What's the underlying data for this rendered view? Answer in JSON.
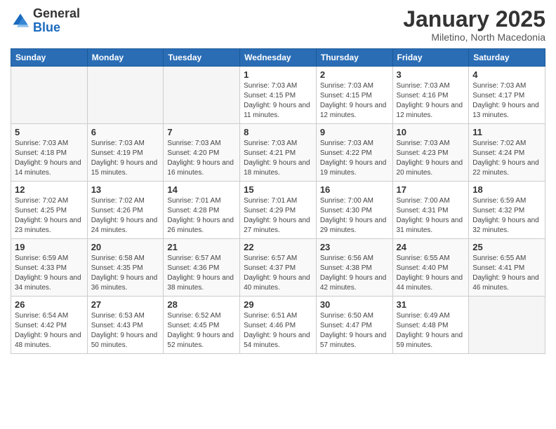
{
  "header": {
    "logo_general": "General",
    "logo_blue": "Blue",
    "month": "January 2025",
    "location": "Miletino, North Macedonia"
  },
  "days_of_week": [
    "Sunday",
    "Monday",
    "Tuesday",
    "Wednesday",
    "Thursday",
    "Friday",
    "Saturday"
  ],
  "weeks": [
    [
      {
        "day": "",
        "empty": true
      },
      {
        "day": "",
        "empty": true
      },
      {
        "day": "",
        "empty": true
      },
      {
        "day": "1",
        "sunrise": "7:03 AM",
        "sunset": "4:15 PM",
        "daylight": "9 hours and 11 minutes."
      },
      {
        "day": "2",
        "sunrise": "7:03 AM",
        "sunset": "4:15 PM",
        "daylight": "9 hours and 12 minutes."
      },
      {
        "day": "3",
        "sunrise": "7:03 AM",
        "sunset": "4:16 PM",
        "daylight": "9 hours and 12 minutes."
      },
      {
        "day": "4",
        "sunrise": "7:03 AM",
        "sunset": "4:17 PM",
        "daylight": "9 hours and 13 minutes."
      }
    ],
    [
      {
        "day": "5",
        "sunrise": "7:03 AM",
        "sunset": "4:18 PM",
        "daylight": "9 hours and 14 minutes."
      },
      {
        "day": "6",
        "sunrise": "7:03 AM",
        "sunset": "4:19 PM",
        "daylight": "9 hours and 15 minutes."
      },
      {
        "day": "7",
        "sunrise": "7:03 AM",
        "sunset": "4:20 PM",
        "daylight": "9 hours and 16 minutes."
      },
      {
        "day": "8",
        "sunrise": "7:03 AM",
        "sunset": "4:21 PM",
        "daylight": "9 hours and 18 minutes."
      },
      {
        "day": "9",
        "sunrise": "7:03 AM",
        "sunset": "4:22 PM",
        "daylight": "9 hours and 19 minutes."
      },
      {
        "day": "10",
        "sunrise": "7:03 AM",
        "sunset": "4:23 PM",
        "daylight": "9 hours and 20 minutes."
      },
      {
        "day": "11",
        "sunrise": "7:02 AM",
        "sunset": "4:24 PM",
        "daylight": "9 hours and 22 minutes."
      }
    ],
    [
      {
        "day": "12",
        "sunrise": "7:02 AM",
        "sunset": "4:25 PM",
        "daylight": "9 hours and 23 minutes."
      },
      {
        "day": "13",
        "sunrise": "7:02 AM",
        "sunset": "4:26 PM",
        "daylight": "9 hours and 24 minutes."
      },
      {
        "day": "14",
        "sunrise": "7:01 AM",
        "sunset": "4:28 PM",
        "daylight": "9 hours and 26 minutes."
      },
      {
        "day": "15",
        "sunrise": "7:01 AM",
        "sunset": "4:29 PM",
        "daylight": "9 hours and 27 minutes."
      },
      {
        "day": "16",
        "sunrise": "7:00 AM",
        "sunset": "4:30 PM",
        "daylight": "9 hours and 29 minutes."
      },
      {
        "day": "17",
        "sunrise": "7:00 AM",
        "sunset": "4:31 PM",
        "daylight": "9 hours and 31 minutes."
      },
      {
        "day": "18",
        "sunrise": "6:59 AM",
        "sunset": "4:32 PM",
        "daylight": "9 hours and 32 minutes."
      }
    ],
    [
      {
        "day": "19",
        "sunrise": "6:59 AM",
        "sunset": "4:33 PM",
        "daylight": "9 hours and 34 minutes."
      },
      {
        "day": "20",
        "sunrise": "6:58 AM",
        "sunset": "4:35 PM",
        "daylight": "9 hours and 36 minutes."
      },
      {
        "day": "21",
        "sunrise": "6:57 AM",
        "sunset": "4:36 PM",
        "daylight": "9 hours and 38 minutes."
      },
      {
        "day": "22",
        "sunrise": "6:57 AM",
        "sunset": "4:37 PM",
        "daylight": "9 hours and 40 minutes."
      },
      {
        "day": "23",
        "sunrise": "6:56 AM",
        "sunset": "4:38 PM",
        "daylight": "9 hours and 42 minutes."
      },
      {
        "day": "24",
        "sunrise": "6:55 AM",
        "sunset": "4:40 PM",
        "daylight": "9 hours and 44 minutes."
      },
      {
        "day": "25",
        "sunrise": "6:55 AM",
        "sunset": "4:41 PM",
        "daylight": "9 hours and 46 minutes."
      }
    ],
    [
      {
        "day": "26",
        "sunrise": "6:54 AM",
        "sunset": "4:42 PM",
        "daylight": "9 hours and 48 minutes."
      },
      {
        "day": "27",
        "sunrise": "6:53 AM",
        "sunset": "4:43 PM",
        "daylight": "9 hours and 50 minutes."
      },
      {
        "day": "28",
        "sunrise": "6:52 AM",
        "sunset": "4:45 PM",
        "daylight": "9 hours and 52 minutes."
      },
      {
        "day": "29",
        "sunrise": "6:51 AM",
        "sunset": "4:46 PM",
        "daylight": "9 hours and 54 minutes."
      },
      {
        "day": "30",
        "sunrise": "6:50 AM",
        "sunset": "4:47 PM",
        "daylight": "9 hours and 57 minutes."
      },
      {
        "day": "31",
        "sunrise": "6:49 AM",
        "sunset": "4:48 PM",
        "daylight": "9 hours and 59 minutes."
      },
      {
        "day": "",
        "empty": true
      }
    ]
  ]
}
